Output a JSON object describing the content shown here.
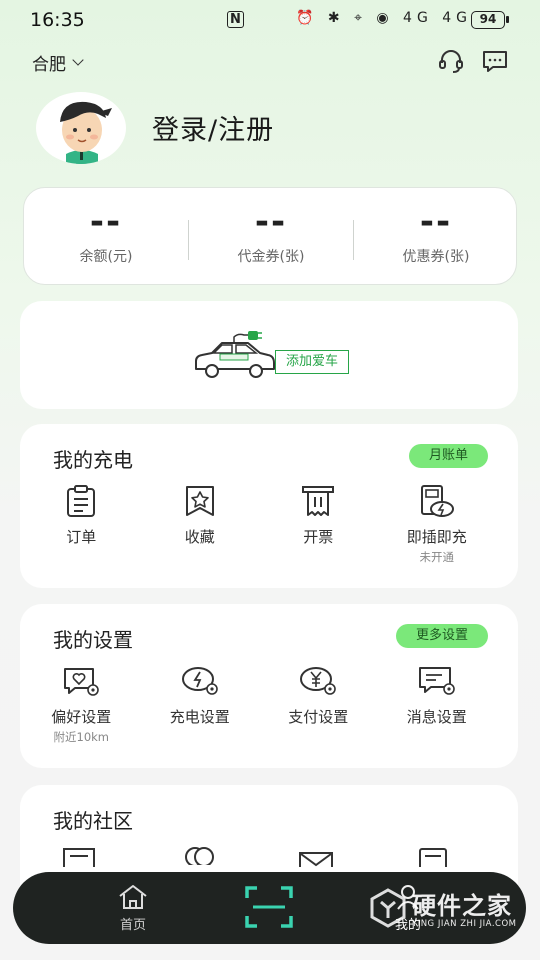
{
  "status": {
    "time": "16:35",
    "nfc": "N",
    "icons": "⏰ ✱ ⌖ ◉ 4G 4G",
    "battery": "94"
  },
  "header": {
    "city": "合肥",
    "service_icon": "headset-icon",
    "message_icon": "message-icon"
  },
  "profile": {
    "login_text": "登录/注册",
    "avatar_icon": "avatar-icon"
  },
  "balance": [
    {
      "value": "--",
      "label": "余额(元)"
    },
    {
      "value": "--",
      "label": "代金券(张)"
    },
    {
      "value": "--",
      "label": "优惠券(张)"
    }
  ],
  "add_car": {
    "button": "添加爱车",
    "car_icon": "car-icon"
  },
  "charging": {
    "title": "我的充电",
    "pill": "月账单",
    "items": [
      {
        "label": "订单",
        "icon": "order-icon"
      },
      {
        "label": "收藏",
        "icon": "favorite-icon"
      },
      {
        "label": "开票",
        "icon": "invoice-icon"
      },
      {
        "label": "即插即充",
        "sub": "未开通",
        "icon": "plug-charge-icon"
      }
    ]
  },
  "settings": {
    "title": "我的设置",
    "pill": "更多设置",
    "items": [
      {
        "label": "偏好设置",
        "sub": "附近10km",
        "icon": "preference-icon"
      },
      {
        "label": "充电设置",
        "icon": "charge-settings-icon"
      },
      {
        "label": "支付设置",
        "icon": "payment-settings-icon"
      },
      {
        "label": "消息设置",
        "icon": "message-settings-icon"
      }
    ]
  },
  "community": {
    "title": "我的社区"
  },
  "tabbar": {
    "home": "首页",
    "mine": "我的",
    "scan_icon": "scan-icon"
  },
  "watermark": {
    "big": "硬件之家",
    "small": "YING JIAN ZHI JIA.COM"
  },
  "colors": {
    "accent": "#27a548",
    "pill": "#7be87a",
    "tabbar": "#1f2321",
    "scan": "#3ad3b0"
  }
}
